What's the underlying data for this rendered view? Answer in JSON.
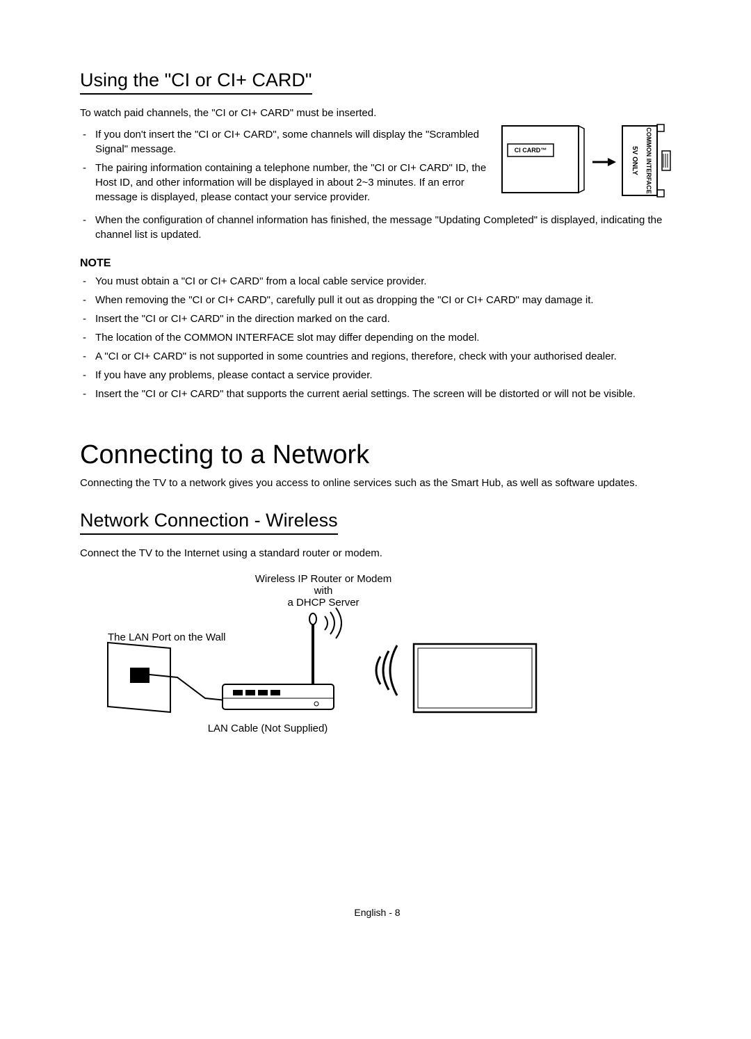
{
  "section1": {
    "heading": "Using the \"CI or CI+ CARD\"",
    "intro": "To watch paid channels, the \"CI or CI+ CARD\" must be inserted.",
    "topItems": [
      "If you don't insert the \"CI or CI+ CARD\", some channels will display the \"Scrambled Signal\" message.",
      "The pairing information containing a telephone number, the \"CI or CI+ CARD\" ID, the Host ID, and other information will be displayed in about 2~3 minutes. If an error message is displayed, please contact your service provider."
    ],
    "fullwidthItems": [
      "When the configuration of channel information has finished, the message \"Updating Completed\" is displayed, indicating the channel list is updated."
    ],
    "noteHeading": "NOTE",
    "noteItems": [
      "You must obtain a \"CI or CI+ CARD\" from a local cable service provider.",
      "When removing the \"CI or CI+ CARD\", carefully pull it out as dropping the \"CI or CI+ CARD\" may damage it.",
      "Insert the \"CI or CI+ CARD\" in the direction marked on the card.",
      "The location of the COMMON INTERFACE slot may differ depending on the model.",
      "A \"CI or CI+ CARD\" is not supported in some countries and regions, therefore, check with your authorised dealer.",
      "If you have any problems, please contact a service provider.",
      "Insert the \"CI or CI+ CARD\" that supports the current aerial settings. The screen will be distorted or will not be visible."
    ],
    "diagram": {
      "cardLabel": "CI CARD™",
      "slotLabel1": "5V ONLY",
      "slotLabel2": "COMMON INTERFACE"
    }
  },
  "section2": {
    "heading": "Connecting to a Network",
    "intro": "Connecting the TV to a network gives you access to online services such as the Smart Hub, as well as software updates."
  },
  "section3": {
    "heading": "Network Connection - Wireless",
    "intro": "Connect the TV to the Internet using a standard router or modem.",
    "diagram": {
      "routerLabel1": "Wireless IP Router or Modem with",
      "routerLabel2": "a DHCP Server",
      "wallLabel": "The LAN Port on the Wall",
      "cableLabel": "LAN Cable (Not Supplied)"
    }
  },
  "footer": "English - 8"
}
